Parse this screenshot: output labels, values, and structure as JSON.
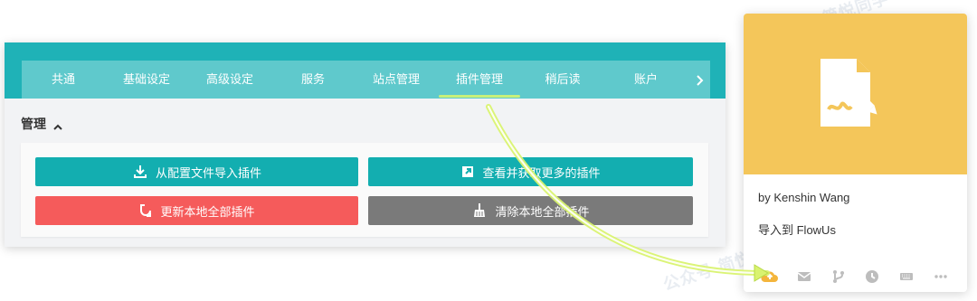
{
  "settings": {
    "nav": {
      "items": [
        {
          "label": "共通",
          "active": false
        },
        {
          "label": "基础设定",
          "active": false
        },
        {
          "label": "高级设定",
          "active": false
        },
        {
          "label": "服务",
          "active": false
        },
        {
          "label": "站点管理",
          "active": false
        },
        {
          "label": "插件管理",
          "active": true
        },
        {
          "label": "稍后读",
          "active": false
        },
        {
          "label": "账户",
          "active": false
        }
      ]
    },
    "section": {
      "title": "管理"
    },
    "buttons": {
      "import_from_config": "从配置文件导入插件",
      "view_more_plugins": "查看并获取更多的插件",
      "update_all_local": "更新本地全部插件",
      "clear_all_local": "清除本地全部插件"
    },
    "watermark": {
      "text": "公众号·简悦同学"
    },
    "colors": {
      "nav_dark": "#1fb2b7",
      "nav_light": "#5fc9cc",
      "button_teal": "#13aeb0",
      "button_red": "#f55b5b",
      "button_gray": "#7a7a7a",
      "highlight": "#c8f07a"
    }
  },
  "card": {
    "author": "by Kenshin Wang",
    "import_label": "导入到 FlowUs",
    "cover_color": "#f4c65a",
    "actions": [
      {
        "name": "cloud-upload-icon",
        "active": true
      },
      {
        "name": "mail-icon",
        "active": false
      },
      {
        "name": "branch-icon",
        "active": false
      },
      {
        "name": "clock-icon",
        "active": false
      },
      {
        "name": "keyboard-icon",
        "active": false
      },
      {
        "name": "more-icon",
        "active": false
      }
    ]
  }
}
